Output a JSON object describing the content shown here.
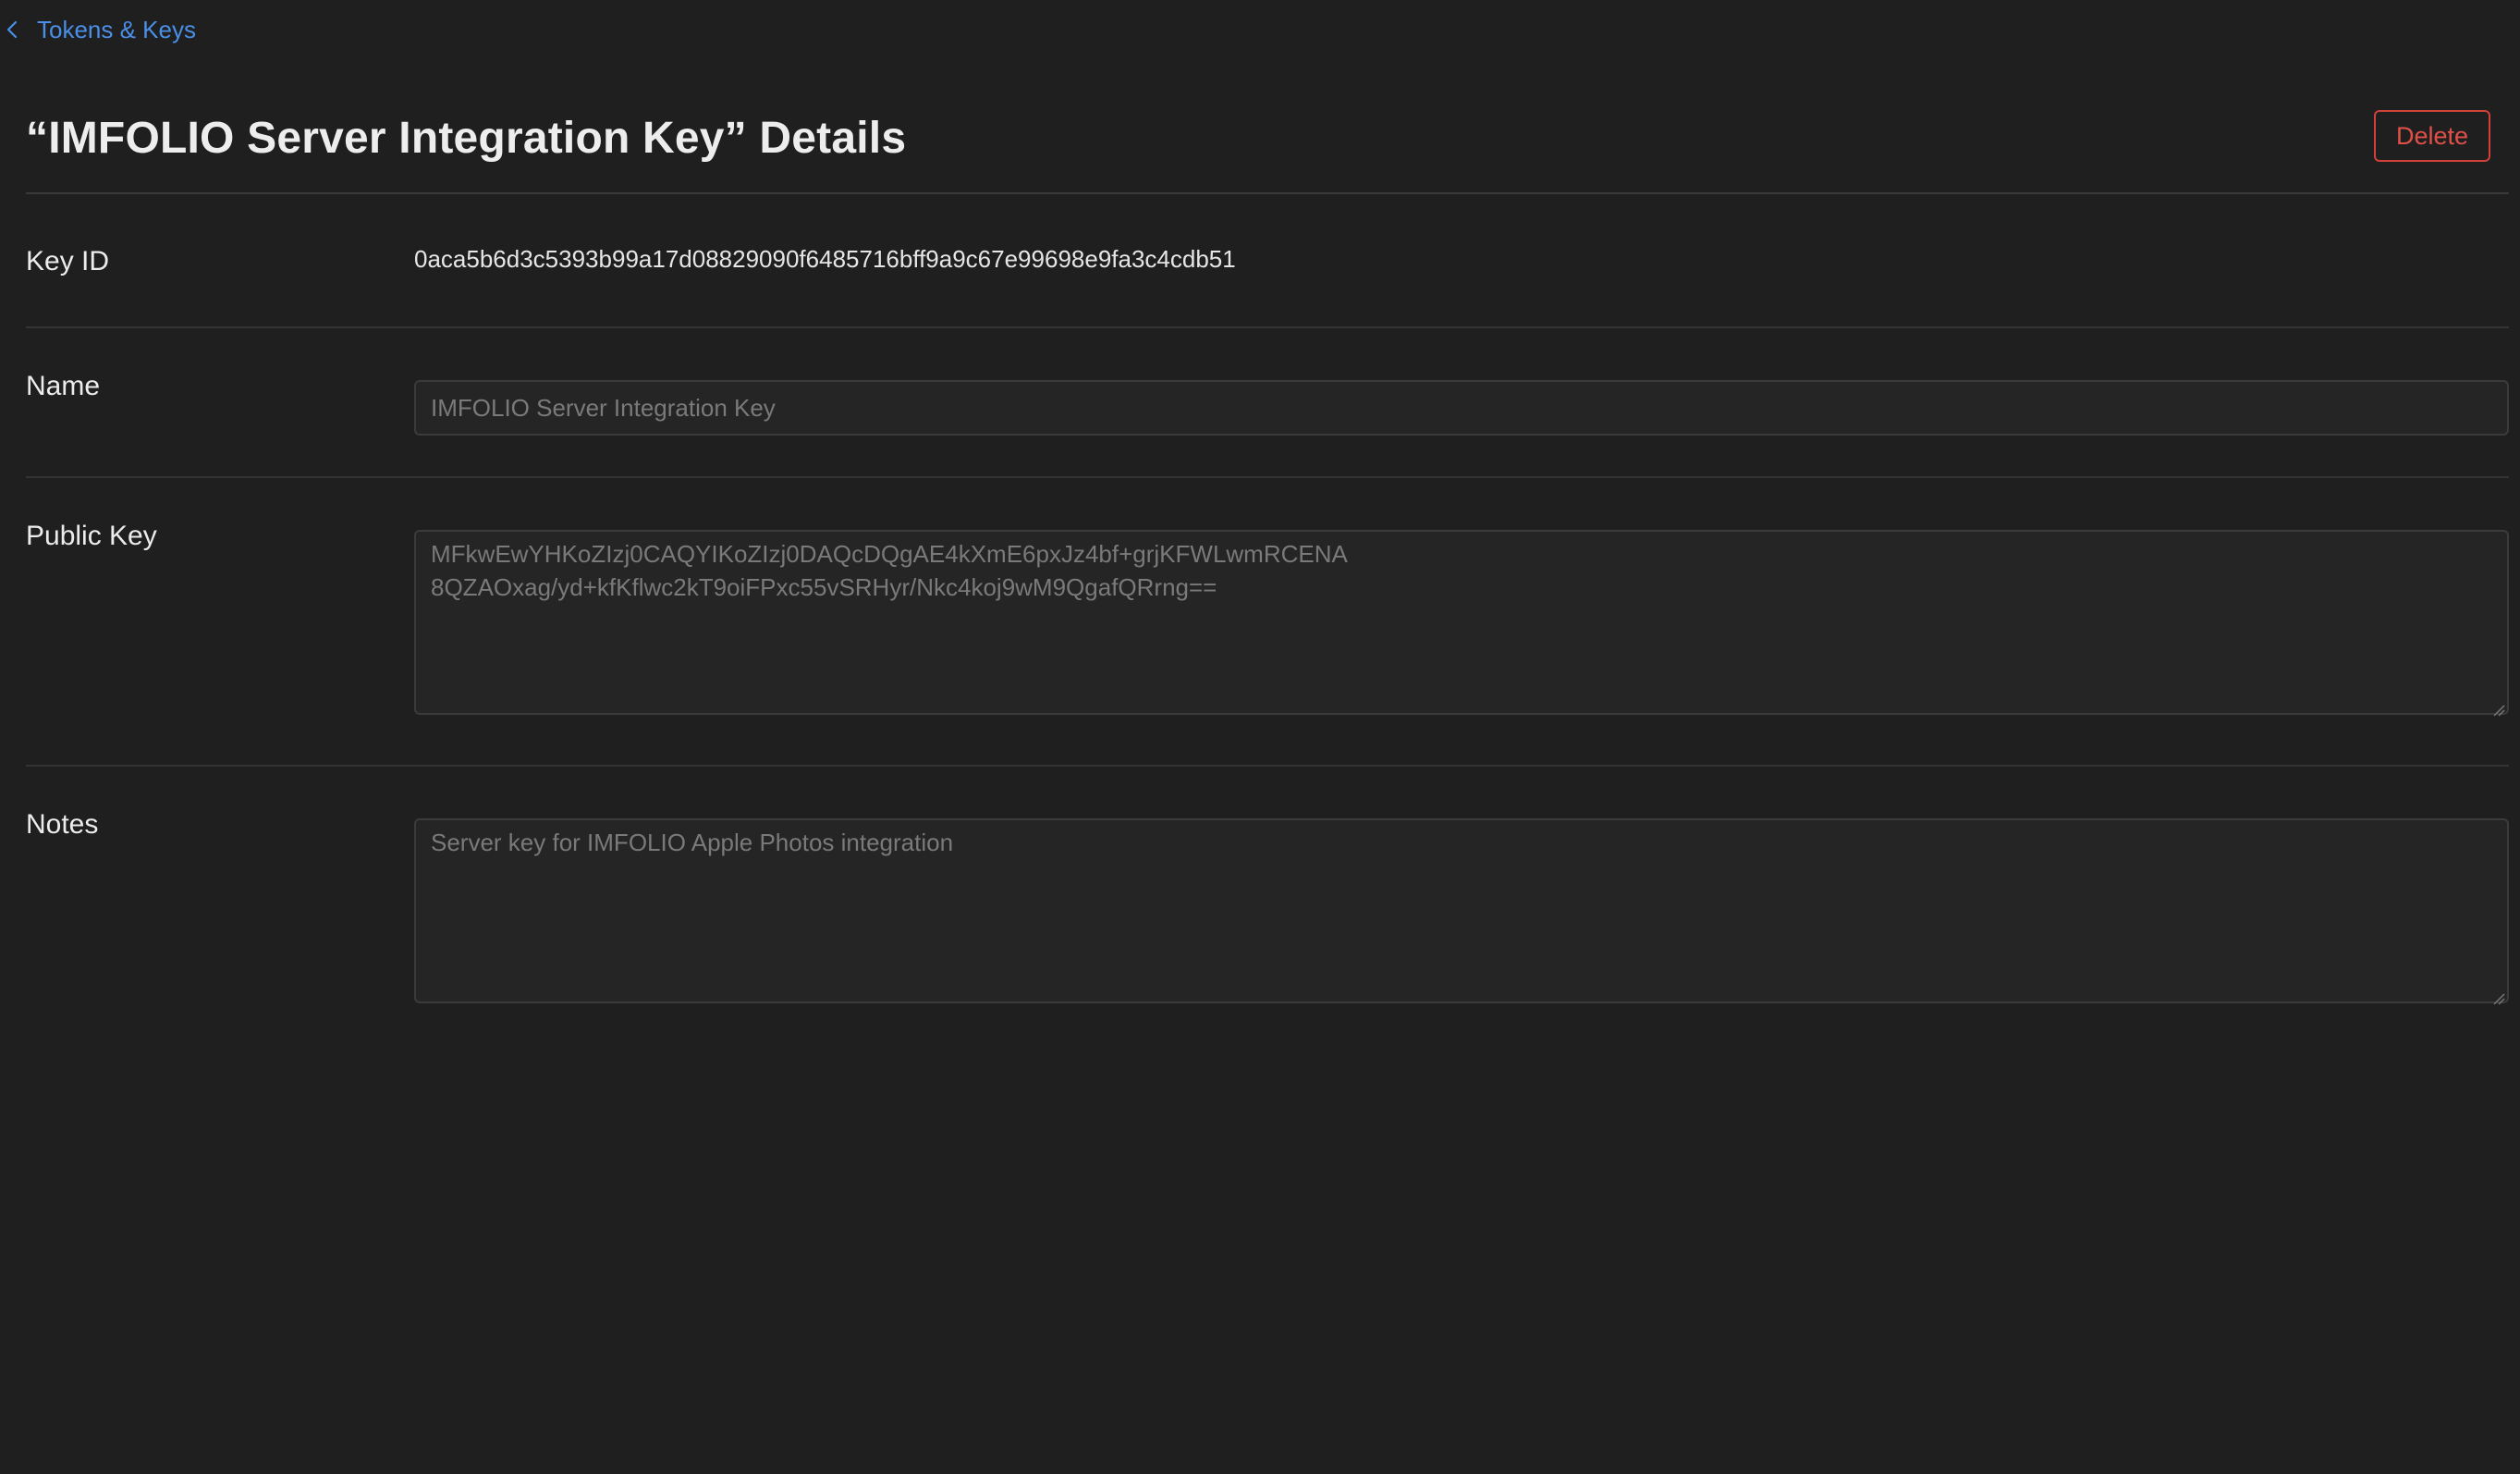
{
  "nav": {
    "back_label": "Tokens & Keys",
    "back_icon": "chevron-left-icon"
  },
  "header": {
    "title": "“IMFOLIO Server Integration Key” Details",
    "delete_label": "Delete"
  },
  "fields": {
    "key_id": {
      "label": "Key ID",
      "value": "0aca5b6d3c5393b99a17d08829090f6485716bff9a9c67e99698e9fa3c4cdb51"
    },
    "name": {
      "label": "Name",
      "placeholder": "IMFOLIO Server Integration Key"
    },
    "public_key": {
      "label": "Public Key",
      "placeholder": "MFkwEwYHKoZIzj0CAQYIKoZIzj0DAQcDQgAE4kXmE6pxJz4bf+grjKFWLwmRCENA\n8QZAOxag/yd+kfKflwc2kT9oiFPxc55vSRHyr/Nkc4koj9wM9QgafQRrng=="
    },
    "notes": {
      "label": "Notes",
      "placeholder": "Server key for IMFOLIO Apple Photos integration"
    }
  },
  "colors": {
    "background": "#1f1f1f",
    "link": "#4a8fe7",
    "danger": "#e05048",
    "field_bg": "#252525",
    "field_border": "#3b3b3b"
  }
}
